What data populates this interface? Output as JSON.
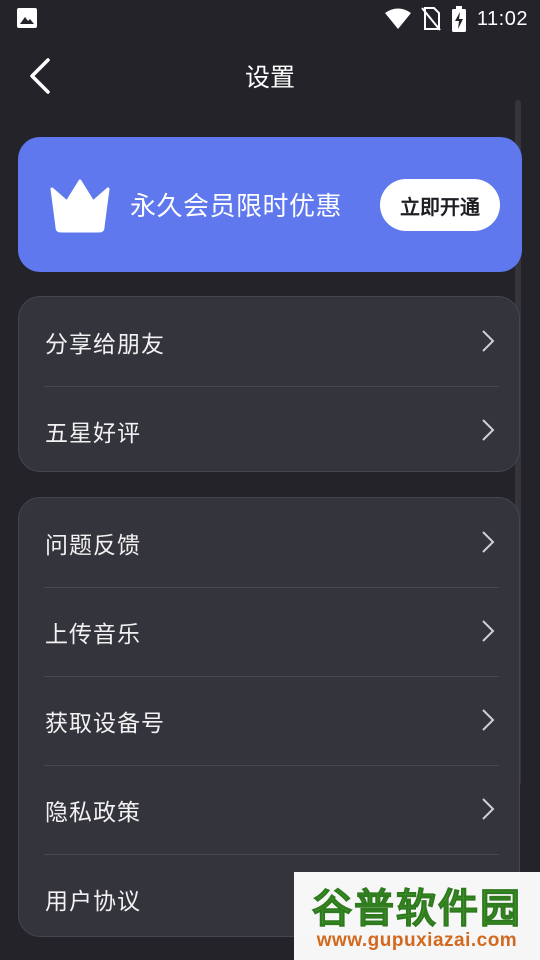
{
  "status_bar": {
    "time": "11:02",
    "icons": [
      "gallery-icon",
      "wifi-icon",
      "no-sim-icon",
      "battery-charging-icon"
    ]
  },
  "header": {
    "title": "设置",
    "back_icon": "back-arrow-icon"
  },
  "vip_banner": {
    "text": "永久会员限时优惠",
    "button_label": "立即开通",
    "icon": "crown-icon",
    "color": "#5f78ed"
  },
  "group1": {
    "items": [
      {
        "label": "分享给朋友"
      },
      {
        "label": "五星好评"
      }
    ]
  },
  "group2": {
    "items": [
      {
        "label": "问题反馈"
      },
      {
        "label": "上传音乐"
      },
      {
        "label": "获取设备号"
      },
      {
        "label": "隐私政策"
      },
      {
        "label": "用户协议"
      }
    ]
  },
  "watermark": {
    "title": "谷普软件园",
    "url": "www.gupuxiazai.com"
  },
  "colors": {
    "background": "#232329",
    "card": "#34343c",
    "accent": "#5f78ed"
  }
}
